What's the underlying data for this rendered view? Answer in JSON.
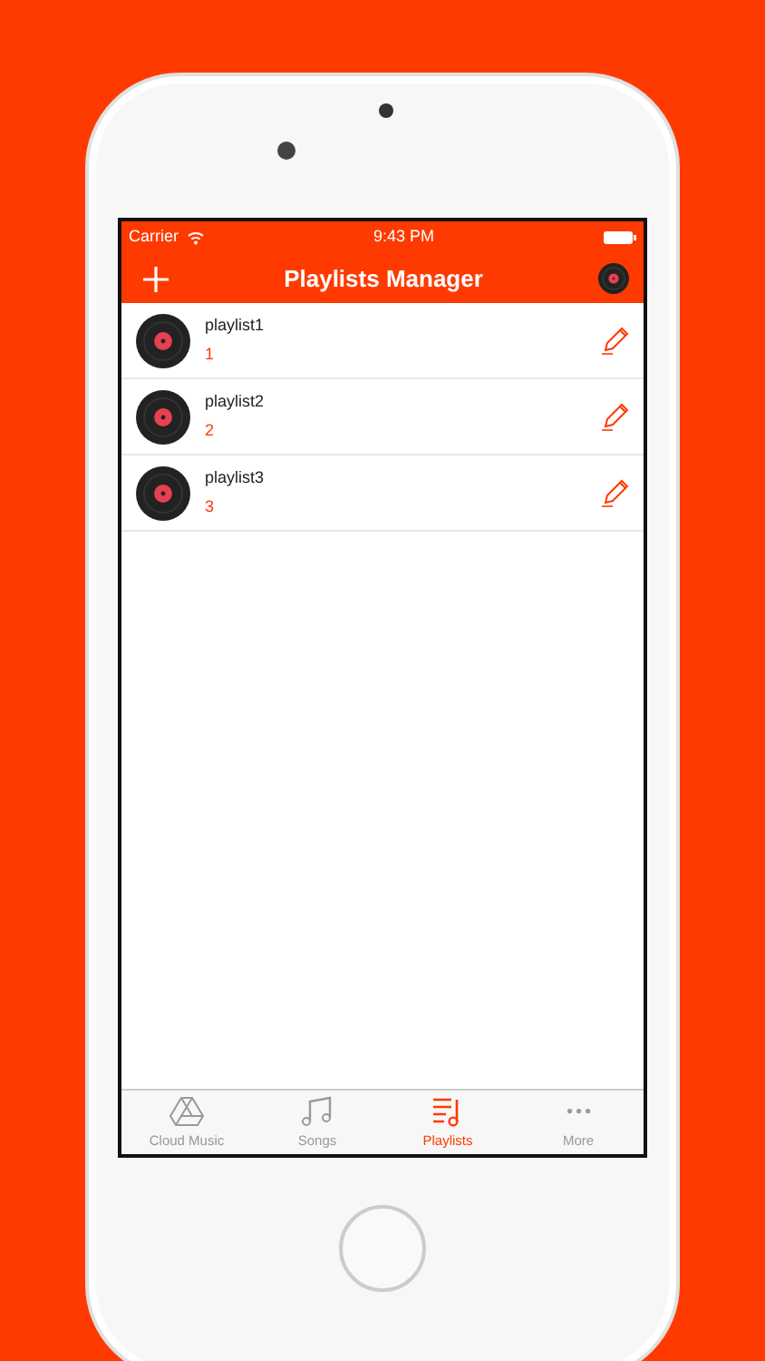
{
  "status_bar": {
    "carrier": "Carrier",
    "time": "9:43 PM"
  },
  "nav_bar": {
    "title": "Playlists Manager"
  },
  "playlists": [
    {
      "name": "playlist1",
      "count": "1"
    },
    {
      "name": "playlist2",
      "count": "2"
    },
    {
      "name": "playlist3",
      "count": "3"
    }
  ],
  "tab_bar": [
    {
      "kind": "drive",
      "label": "Cloud Music",
      "selected": false
    },
    {
      "kind": "note",
      "label": "Songs",
      "selected": false
    },
    {
      "kind": "list",
      "label": "Playlists",
      "selected": true
    },
    {
      "kind": "more",
      "label": "More",
      "selected": false
    }
  ]
}
